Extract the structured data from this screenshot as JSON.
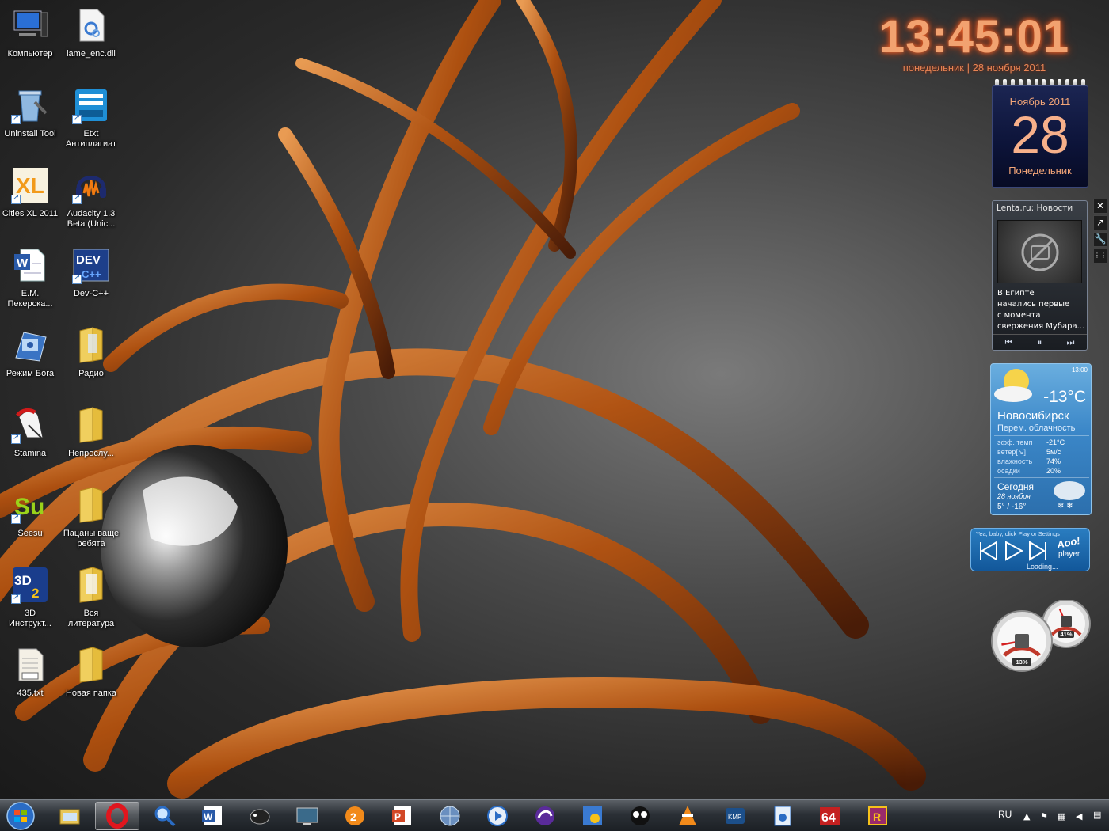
{
  "desktop": {
    "icons": [
      {
        "label": "Компьютер",
        "icon": "computer-icon"
      },
      {
        "label": "lame_enc.dll",
        "icon": "dll-file-icon"
      },
      {
        "label": "Uninstall Tool",
        "icon": "uninstall-tool-icon"
      },
      {
        "label": "Etxt\nАнтиплагиат",
        "icon": "etxt-icon"
      },
      {
        "label": "Cities XL 2011",
        "icon": "cities-xl-icon"
      },
      {
        "label": "Audacity 1.3\nBeta (Unic...",
        "icon": "audacity-icon"
      },
      {
        "label": "Е.М.\nПекерска...",
        "icon": "word-document-icon"
      },
      {
        "label": "Dev-C++",
        "icon": "dev-cpp-icon"
      },
      {
        "label": "Режим Бога",
        "icon": "god-mode-icon"
      },
      {
        "label": "Радио",
        "icon": "folder-icon"
      },
      {
        "label": "Stamina",
        "icon": "stamina-icon"
      },
      {
        "label": "Непрослу...",
        "icon": "folder-icon"
      },
      {
        "label": "Seesu",
        "icon": "seesu-icon"
      },
      {
        "label": "Пацаны ваще\nребята",
        "icon": "folder-icon"
      },
      {
        "label": "3D\nИнструкт...",
        "icon": "3d-instructor-icon"
      },
      {
        "label": "Вся\nлитература",
        "icon": "folder-icon"
      },
      {
        "label": "435.txt",
        "icon": "text-file-icon"
      },
      {
        "label": "Новая папка",
        "icon": "folder-icon"
      }
    ]
  },
  "clock": {
    "time": "13:45:01",
    "date": "понедельник | 28 ноября 2011"
  },
  "calendar": {
    "month": "Ноябрь 2011",
    "day": "28",
    "weekday": "Понедельник"
  },
  "news": {
    "title": "Lenta.ru: Новости",
    "text": "В Египте\nначались первые\nс момента\nсвержения Мубара..."
  },
  "weather": {
    "time": "13:00",
    "temp": "-13°C",
    "city": "Новосибирск",
    "condition": "Перем. облачность",
    "details": [
      {
        "k": "эфф. темп",
        "v": "-21°C"
      },
      {
        "k": "ветер[↘]",
        "v": "5м/с"
      },
      {
        "k": "влажность",
        "v": "74%"
      },
      {
        "k": "осадки",
        "v": "20%"
      }
    ],
    "forecast_label": "Сегодня",
    "forecast_date": "28 ноября",
    "forecast_temps": "5°  /  -16°"
  },
  "player": {
    "hint": "Yea, baby, click Play or Settings",
    "brand": "Aoo!",
    "sub": "player",
    "status": "Loading..."
  },
  "meters": {
    "cpu": "13%",
    "memory": "41%",
    "cpu_level": 0.13,
    "memory_level": 0.41
  },
  "taskbar": {
    "apps": [
      "explorer-icon",
      "opera-icon",
      "search-tool-icon",
      "word-icon",
      "sheep-icon",
      "display-icon",
      "icq-icon",
      "powerpoint-icon",
      "network-globe-icon",
      "media-player-icon",
      "browser-swirl-icon",
      "settings-gear-icon",
      "face-icon",
      "vlc-icon",
      "kmplayer-icon",
      "disk-tool-icon",
      "aida64-icon",
      "winrar-icon"
    ],
    "active_index": 1,
    "lang": "RU"
  },
  "colors": {
    "clock": "#f2a270",
    "accent": "#d2691e",
    "weather_bg": "#3b87c8"
  }
}
